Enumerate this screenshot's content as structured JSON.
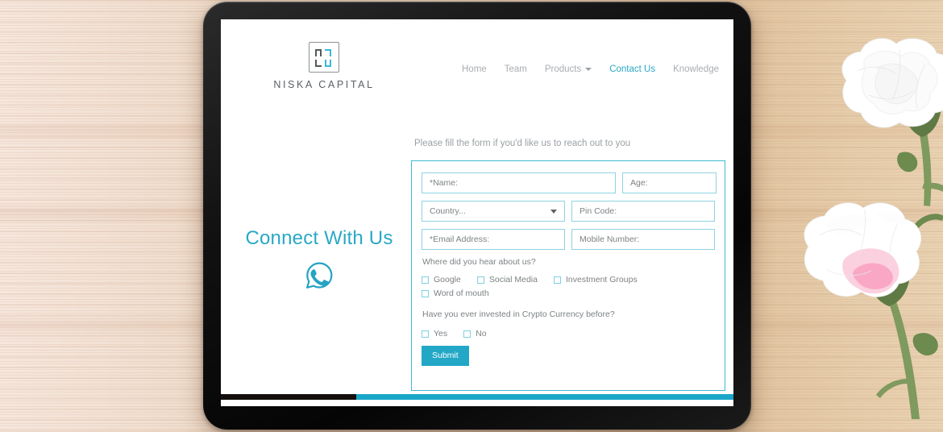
{
  "scene": {
    "background": "bamboo-wood-surface",
    "device": "black-tablet",
    "decor": [
      "white-carnation-top",
      "pink-white-carnation-bottom"
    ]
  },
  "colors": {
    "accent_teal": "#2aa8c6",
    "accent_teal_border": "#3fb9d2",
    "field_border": "#8fd3e2",
    "submit_bg": "#22a7c6",
    "muted_text": "#7d8285",
    "nav_text": "#a9aeb1",
    "logo_gray": "#55595b",
    "logo_teal": "#3bb7d6",
    "footer_dark": "#140f0d",
    "footer_teal": "#19a6c8",
    "bezel": "#111111",
    "wood": "#eedac7"
  },
  "brand": {
    "name": "NISKA CAPITAL",
    "logo_icon": "niska-capital-monogram"
  },
  "nav": {
    "items": [
      {
        "label": "Home",
        "active": false,
        "dropdown": false
      },
      {
        "label": "Team",
        "active": false,
        "dropdown": false
      },
      {
        "label": "Products",
        "active": false,
        "dropdown": true
      },
      {
        "label": "Contact Us",
        "active": true,
        "dropdown": false
      },
      {
        "label": "Knowledge",
        "active": false,
        "dropdown": false
      }
    ]
  },
  "intro": {
    "text": "Please fill the form if you'd like us to reach out to you"
  },
  "left": {
    "title": "Connect With Us",
    "icon": "whatsapp-icon"
  },
  "form": {
    "fields": {
      "name": {
        "placeholder": "*Name:",
        "value": ""
      },
      "age": {
        "placeholder": "Age:",
        "value": ""
      },
      "country": {
        "placeholder": "Country...",
        "value": "",
        "icon": "chevron-down-icon"
      },
      "pin": {
        "placeholder": "Pin Code:",
        "value": ""
      },
      "email": {
        "placeholder": "*Email Address:",
        "value": ""
      },
      "mobile": {
        "placeholder": "Mobile Number:",
        "value": ""
      }
    },
    "source_question": "Where did you hear about us?",
    "source_options": [
      {
        "label": "Google",
        "checked": false
      },
      {
        "label": "Social Media",
        "checked": false
      },
      {
        "label": "Investment Groups",
        "checked": false
      },
      {
        "label": "Word of mouth",
        "checked": false
      }
    ],
    "crypto_question": "Have you ever invested in Crypto Currency before?",
    "crypto_options": [
      {
        "label": "Yes",
        "checked": false
      },
      {
        "label": "No",
        "checked": false
      }
    ],
    "submit_label": "Submit"
  }
}
